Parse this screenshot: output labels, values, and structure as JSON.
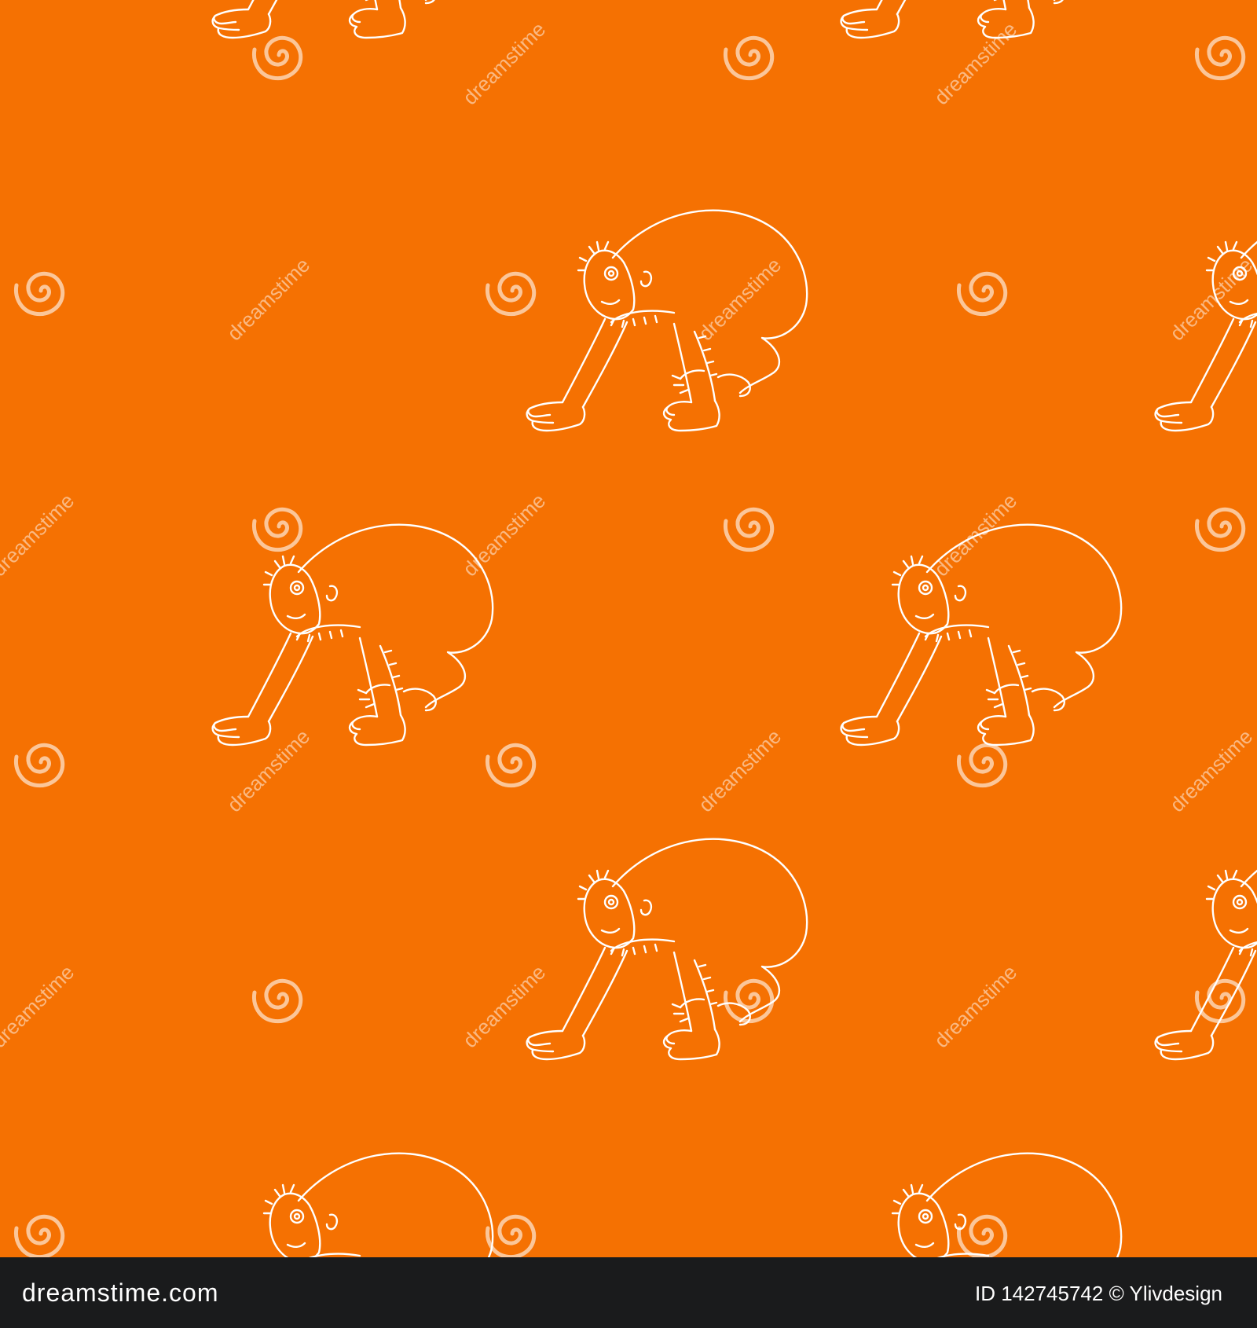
{
  "colors": {
    "background": "#f57102",
    "line": "#ffffff",
    "watermark": "#ffffff",
    "footer_background": "#1a1b1c"
  },
  "pattern": {
    "motif_icon": "monkey-outline-icon",
    "watermark_icon": "dreamstime-spiral-logo-icon",
    "watermark_text": "dreamstime"
  },
  "footer": {
    "logo_text": "dreamstime.com",
    "credit_text": "ID 142745742 © Ylivdesign"
  }
}
